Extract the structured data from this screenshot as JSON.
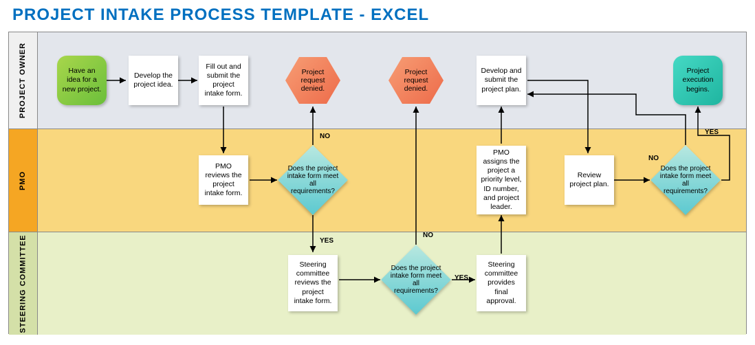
{
  "title": "PROJECT INTAKE PROCESS TEMPLATE - EXCEL",
  "lanes": {
    "owner": "PROJECT OWNER",
    "pmo": "PMO",
    "steer": "STEERING COMMITTEE"
  },
  "nodes": {
    "n1": "Have an idea for a new project.",
    "n2": "Develop the project idea.",
    "n3": "Fill out and submit the project intake form.",
    "n4": "PMO reviews the project intake form.",
    "d1": "Does the project intake form meet all requirements?",
    "deny1": "Project request denied.",
    "n5": "Steering committee reviews the project intake form.",
    "d2": "Does the project intake form meet all requirements?",
    "deny2": "Project request denied.",
    "n6": "Steering committee provides final approval.",
    "n7": "PMO assigns the project a priority level, ID number, and project leader.",
    "n8": "Develop and submit the project plan.",
    "n9": "Review project plan.",
    "d3": "Does the project intake form meet all requirements?",
    "n10": "Project execution begins."
  },
  "labels": {
    "yes": "YES",
    "no": "NO"
  },
  "chart_data": {
    "type": "flowchart-swimlane",
    "title": "PROJECT INTAKE PROCESS TEMPLATE - EXCEL",
    "lanes": [
      "PROJECT OWNER",
      "PMO",
      "STEERING COMMITTEE"
    ],
    "nodes": [
      {
        "id": "n1",
        "lane": "PROJECT OWNER",
        "type": "start",
        "label": "Have an idea for a new project."
      },
      {
        "id": "n2",
        "lane": "PROJECT OWNER",
        "type": "process",
        "label": "Develop the project idea."
      },
      {
        "id": "n3",
        "lane": "PROJECT OWNER",
        "type": "process",
        "label": "Fill out and submit the project intake form."
      },
      {
        "id": "n4",
        "lane": "PMO",
        "type": "process",
        "label": "PMO reviews the project intake form."
      },
      {
        "id": "d1",
        "lane": "PMO",
        "type": "decision",
        "label": "Does the project intake form meet all requirements?"
      },
      {
        "id": "deny1",
        "lane": "PROJECT OWNER",
        "type": "terminator",
        "label": "Project request denied."
      },
      {
        "id": "n5",
        "lane": "STEERING COMMITTEE",
        "type": "process",
        "label": "Steering committee reviews the project intake form."
      },
      {
        "id": "d2",
        "lane": "STEERING COMMITTEE",
        "type": "decision",
        "label": "Does the project intake form meet all requirements?"
      },
      {
        "id": "deny2",
        "lane": "PROJECT OWNER",
        "type": "terminator",
        "label": "Project request denied."
      },
      {
        "id": "n6",
        "lane": "STEERING COMMITTEE",
        "type": "process",
        "label": "Steering committee provides final approval."
      },
      {
        "id": "n7",
        "lane": "PMO",
        "type": "process",
        "label": "PMO assigns the project a priority level, ID number, and project leader."
      },
      {
        "id": "n8",
        "lane": "PROJECT OWNER",
        "type": "process",
        "label": "Develop and submit the project plan."
      },
      {
        "id": "n9",
        "lane": "PMO",
        "type": "process",
        "label": "Review project plan."
      },
      {
        "id": "d3",
        "lane": "PMO",
        "type": "decision",
        "label": "Does the project intake form meet all requirements?"
      },
      {
        "id": "n10",
        "lane": "PROJECT OWNER",
        "type": "end",
        "label": "Project execution begins."
      }
    ],
    "edges": [
      {
        "from": "n1",
        "to": "n2"
      },
      {
        "from": "n2",
        "to": "n3"
      },
      {
        "from": "n3",
        "to": "n4"
      },
      {
        "from": "n4",
        "to": "d1"
      },
      {
        "from": "d1",
        "to": "deny1",
        "label": "NO"
      },
      {
        "from": "d1",
        "to": "n5",
        "label": "YES"
      },
      {
        "from": "n5",
        "to": "d2"
      },
      {
        "from": "d2",
        "to": "deny2",
        "label": "NO"
      },
      {
        "from": "d2",
        "to": "n6",
        "label": "YES"
      },
      {
        "from": "n6",
        "to": "n7"
      },
      {
        "from": "n7",
        "to": "n8"
      },
      {
        "from": "n8",
        "to": "n9"
      },
      {
        "from": "n9",
        "to": "d3"
      },
      {
        "from": "d3",
        "to": "n8",
        "label": "NO"
      },
      {
        "from": "d3",
        "to": "n10",
        "label": "YES"
      }
    ]
  }
}
